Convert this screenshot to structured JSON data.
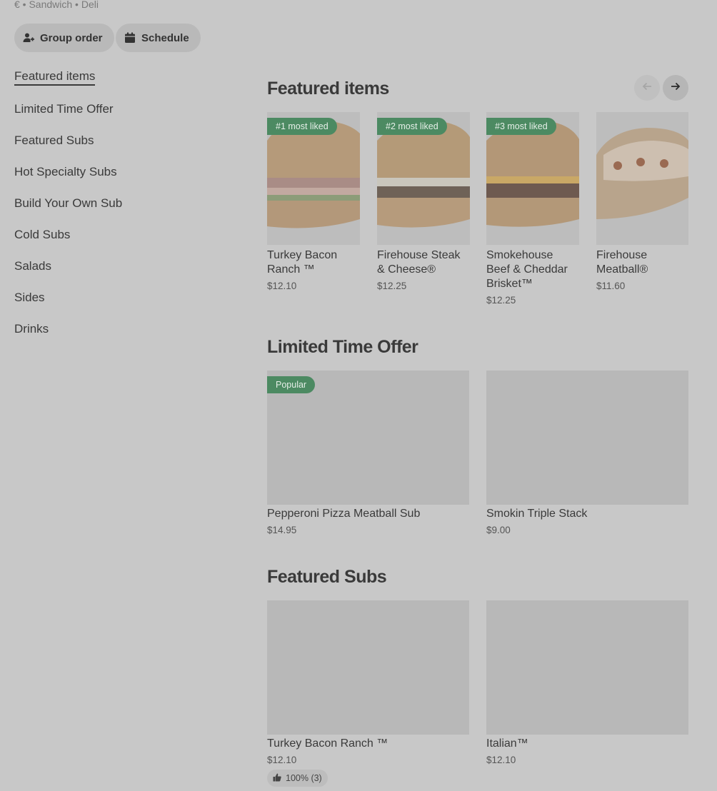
{
  "store": {
    "subtitle": "€ • Sandwich • Deli"
  },
  "actions": {
    "group_order": "Group order",
    "schedule": "Schedule"
  },
  "nav": {
    "items": [
      {
        "label": "Featured items"
      },
      {
        "label": "Limited Time Offer"
      },
      {
        "label": "Featured Subs"
      },
      {
        "label": "Hot Specialty Subs"
      },
      {
        "label": "Build Your Own Sub"
      },
      {
        "label": "Cold Subs"
      },
      {
        "label": "Salads"
      },
      {
        "label": "Sides"
      },
      {
        "label": "Drinks"
      }
    ]
  },
  "featured": {
    "title": "Featured items",
    "items": [
      {
        "badge": "#1 most liked",
        "name": "Turkey Bacon Ranch ™",
        "price": "$12.10"
      },
      {
        "badge": "#2 most liked",
        "name": "Firehouse Steak & Cheese®",
        "price": "$12.25"
      },
      {
        "badge": "#3 most liked",
        "name": "Smokehouse Beef & Cheddar Brisket™",
        "price": "$12.25"
      },
      {
        "name": "Firehouse Meatball®",
        "price": "$11.60"
      }
    ]
  },
  "limited": {
    "title": "Limited Time Offer",
    "items": [
      {
        "badge": "Popular",
        "name": "Pepperoni Pizza Meatball Sub",
        "price": "$14.95"
      },
      {
        "name": "Smokin Triple Stack",
        "price": "$9.00"
      }
    ]
  },
  "subs": {
    "title": "Featured Subs",
    "items": [
      {
        "name": "Turkey Bacon Ranch ™",
        "price": "$12.10",
        "rating": "100% (3)"
      },
      {
        "name": "Italian™",
        "price": "$12.10"
      }
    ]
  },
  "colors": {
    "background": "#c8c8c8",
    "badge": "#4c8a62",
    "placeholder": "#b8b8b8"
  }
}
